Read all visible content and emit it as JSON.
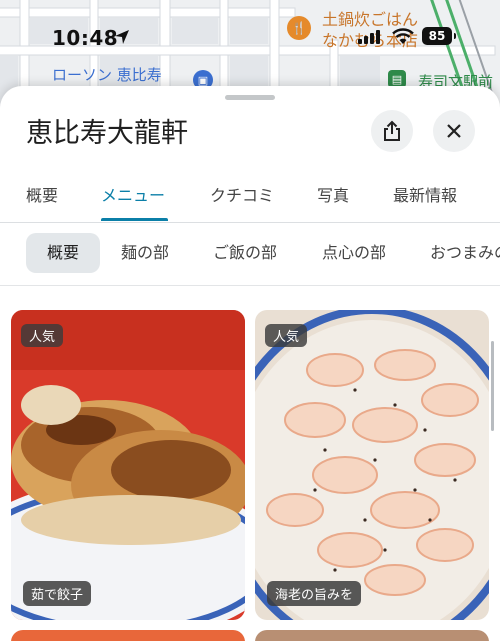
{
  "status_bar": {
    "time": "10:48",
    "battery": "85",
    "icons": [
      "location-arrow-icon",
      "signal-icon",
      "wifi-icon",
      "battery-icon"
    ]
  },
  "map": {
    "labels": {
      "lawson": "ローソン 恵比寿",
      "shop_line1": "土鍋炊ごはん",
      "shop_line2": "なかむら本店",
      "station": "寿司文駅前"
    }
  },
  "place": {
    "title": "恵比寿大龍軒"
  },
  "tabs": [
    {
      "label": "概要"
    },
    {
      "label": "メニュー"
    },
    {
      "label": "クチコミ"
    },
    {
      "label": "写真"
    },
    {
      "label": "最新情報"
    }
  ],
  "active_tab": "メニュー",
  "chips": [
    {
      "label": "概要"
    },
    {
      "label": "麺の部"
    },
    {
      "label": "ご飯の部"
    },
    {
      "label": "点心の部"
    },
    {
      "label": "おつまみの"
    }
  ],
  "menu_items": [
    {
      "badge": "人気",
      "caption": "茹で餃子"
    },
    {
      "badge": "人気",
      "caption": "海老の旨みを"
    }
  ],
  "colors": {
    "accent": "#0b7fa8",
    "sheet_bg": "#ffffff",
    "chip_active_bg": "#e3e7ea"
  }
}
